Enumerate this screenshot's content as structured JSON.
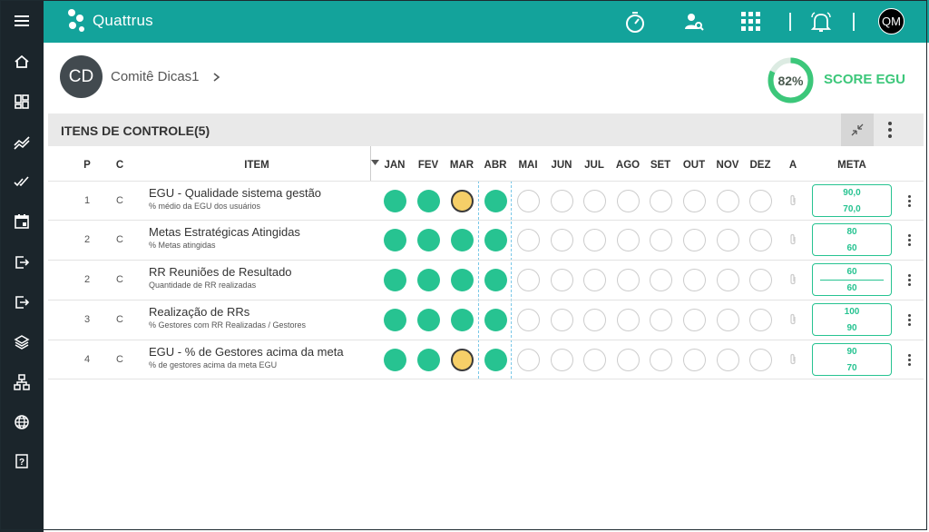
{
  "app": {
    "logo_text": "Quattrus",
    "user_initials": "QM"
  },
  "sidebar": {
    "items": [
      "menu-icon",
      "home-icon",
      "dashboard-icon",
      "chart-icon",
      "double-check-icon",
      "calendar-icon",
      "exit-icon",
      "logout-icon",
      "layers-icon",
      "hierarchy-icon",
      "globe-icon",
      "help-icon"
    ]
  },
  "topbar": {
    "icons": [
      "stopwatch-icon",
      "user-search-icon",
      "apps-grid-icon",
      "bell-icon"
    ]
  },
  "header": {
    "avatar_initials": "CD",
    "breadcrumb": "Comitê Dicas1",
    "score_value": "82%",
    "score_fraction": 0.82,
    "score_label": "SCORE EGU"
  },
  "section": {
    "title": "ITENS DE CONTROLE(5)"
  },
  "table": {
    "columns": {
      "p": "P",
      "c": "C",
      "item": "ITEM",
      "a": "A",
      "meta": "META"
    },
    "months": [
      "JAN",
      "FEV",
      "MAR",
      "ABR",
      "MAI",
      "JUN",
      "JUL",
      "AGO",
      "SET",
      "OUT",
      "NOV",
      "DEZ"
    ],
    "rows": [
      {
        "p": "1",
        "c": "C",
        "title": "EGU - Qualidade sistema gestão",
        "subtitle": "% médio da EGU dos usuários",
        "status": [
          "green",
          "green",
          "yellow",
          "green",
          "empty",
          "empty",
          "empty",
          "empty",
          "empty",
          "empty",
          "empty",
          "empty"
        ],
        "meta1": "90,0",
        "meta2": "70,0",
        "meta_line": false
      },
      {
        "p": "2",
        "c": "C",
        "title": "Metas Estratégicas Atingidas",
        "subtitle": "% Metas atingidas",
        "status": [
          "green",
          "green",
          "green",
          "green",
          "empty",
          "empty",
          "empty",
          "empty",
          "empty",
          "empty",
          "empty",
          "empty"
        ],
        "meta1": "80",
        "meta2": "60",
        "meta_line": false
      },
      {
        "p": "2",
        "c": "C",
        "title": "RR Reuniões de Resultado",
        "subtitle": "Quantidade de RR realizadas",
        "status": [
          "green",
          "green",
          "green",
          "green",
          "empty",
          "empty",
          "empty",
          "empty",
          "empty",
          "empty",
          "empty",
          "empty"
        ],
        "meta1": "60",
        "meta2": "60",
        "meta_line": true
      },
      {
        "p": "3",
        "c": "C",
        "title": "Realização de RRs",
        "subtitle": "% Gestores com RR Realizadas / Gestores",
        "status": [
          "green",
          "green",
          "green",
          "green",
          "empty",
          "empty",
          "empty",
          "empty",
          "empty",
          "empty",
          "empty",
          "empty"
        ],
        "meta1": "100",
        "meta2": "90",
        "meta_line": false
      },
      {
        "p": "4",
        "c": "C",
        "title": "EGU - % de Gestores acima da meta",
        "subtitle": "% de gestores acima da meta EGU",
        "status": [
          "green",
          "green",
          "yellow",
          "green",
          "empty",
          "empty",
          "empty",
          "empty",
          "empty",
          "empty",
          "empty",
          "empty"
        ],
        "meta1": "90",
        "meta2": "70",
        "meta_line": false
      }
    ]
  },
  "colors": {
    "teal": "#13a39b",
    "green": "#27c391",
    "yellow": "#f6cf68",
    "sidebar": "#1b252b"
  }
}
